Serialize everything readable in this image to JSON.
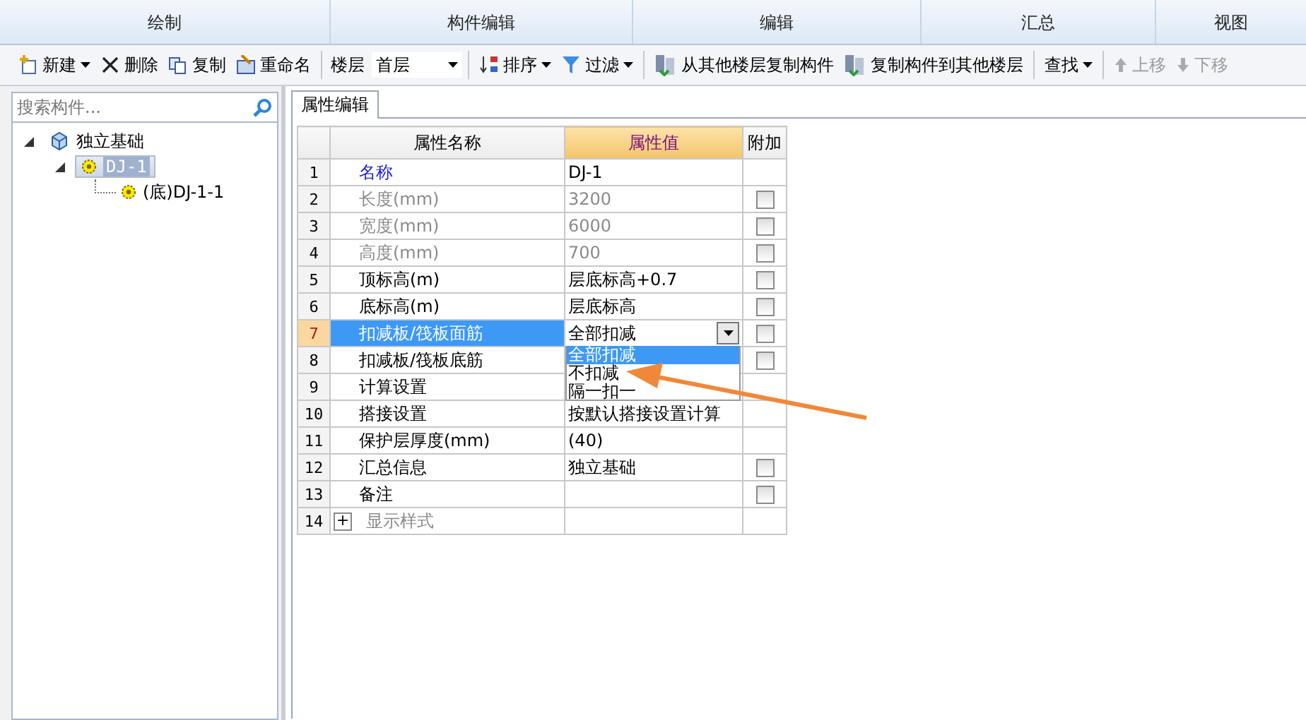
{
  "menu_tabs": [
    {
      "label": "绘制"
    },
    {
      "label": "构件编辑"
    },
    {
      "label": "编辑"
    },
    {
      "label": "汇总"
    },
    {
      "label": "视图"
    }
  ],
  "toolbar": [
    {
      "kind": "button",
      "label": "新建",
      "menu": true,
      "disabled": false
    },
    {
      "kind": "button",
      "label": "删除",
      "menu": false,
      "disabled": false
    },
    {
      "kind": "button",
      "label": "复制",
      "menu": false,
      "disabled": false
    },
    {
      "kind": "button",
      "label": "重命名",
      "menu": false,
      "disabled": false
    },
    {
      "kind": "separator"
    },
    {
      "kind": "label",
      "label": "楼层"
    },
    {
      "kind": "select",
      "value": "首层"
    },
    {
      "kind": "separator"
    },
    {
      "kind": "button",
      "label": "排序",
      "menu": true,
      "disabled": false
    },
    {
      "kind": "button",
      "label": "过滤",
      "menu": true,
      "disabled": false
    },
    {
      "kind": "separator"
    },
    {
      "kind": "button",
      "label": "从其他楼层复制构件",
      "menu": false,
      "disabled": false
    },
    {
      "kind": "button",
      "label": "复制构件到其他楼层",
      "menu": false,
      "disabled": false
    },
    {
      "kind": "separator"
    },
    {
      "kind": "button",
      "label": "查找",
      "menu": true,
      "disabled": false
    },
    {
      "kind": "separator"
    },
    {
      "kind": "button",
      "label": "上移",
      "menu": false,
      "disabled": true
    },
    {
      "kind": "button",
      "label": "下移",
      "menu": false,
      "disabled": true
    }
  ],
  "sidebar": {
    "search": {
      "placeholder": "搜索构件..."
    },
    "tree": [
      {
        "label": "独立基础",
        "expanded": true,
        "selected": false,
        "children": [
          {
            "label": "DJ-1",
            "expanded": true,
            "selected": true,
            "children": [
              {
                "label": "(底)DJ-1-1",
                "selected": false
              }
            ]
          }
        ]
      }
    ]
  },
  "editor": {
    "tab": "属性编辑",
    "columns": [
      {
        "label": "属性名称",
        "sorted": false
      },
      {
        "label": "属性值",
        "sorted": true
      },
      {
        "label": "附加",
        "sorted": false
      }
    ],
    "rows": [
      {
        "no": "1",
        "kind": "link",
        "name": "名称",
        "disabled": false,
        "value": "DJ-1",
        "selected": false
      },
      {
        "no": "2",
        "kind": "text",
        "name": "长度(mm)",
        "disabled": true,
        "value": "3200",
        "checked": false,
        "selected": false
      },
      {
        "no": "3",
        "kind": "text",
        "name": "宽度(mm)",
        "disabled": true,
        "value": "6000",
        "checked": false,
        "selected": false
      },
      {
        "no": "4",
        "kind": "text",
        "name": "高度(mm)",
        "disabled": true,
        "value": "700",
        "checked": false,
        "selected": false
      },
      {
        "no": "5",
        "kind": "text",
        "name": "顶标高(m)",
        "disabled": false,
        "value": "层底标高+0.7",
        "checked": false,
        "selected": false
      },
      {
        "no": "6",
        "kind": "text",
        "name": "底标高(m)",
        "disabled": false,
        "value": "层底标高",
        "checked": false,
        "selected": false
      },
      {
        "no": "7",
        "kind": "text",
        "name": "扣减板/筏板面筋",
        "disabled": false,
        "value": "全部扣减",
        "combo": true,
        "checked": false,
        "selected": true
      },
      {
        "no": "8",
        "kind": "text",
        "name": "扣减板/筏板底筋",
        "disabled": false,
        "checked": false,
        "selected": false
      },
      {
        "no": "9",
        "kind": "text",
        "name": "计算设置",
        "disabled": false,
        "selected": false
      },
      {
        "no": "10",
        "kind": "text",
        "name": "搭接设置",
        "disabled": false,
        "value": "按默认搭接设置计算",
        "selected": false
      },
      {
        "no": "11",
        "kind": "text",
        "name": "保护层厚度(mm)",
        "disabled": false,
        "value": "(40)",
        "selected": false
      },
      {
        "no": "12",
        "kind": "text",
        "name": "汇总信息",
        "disabled": false,
        "value": "独立基础",
        "checked": false,
        "selected": false
      },
      {
        "no": "13",
        "kind": "text",
        "name": "备注",
        "disabled": false,
        "checked": false,
        "selected": false
      },
      {
        "no": "14",
        "kind": "group",
        "expander": "+",
        "name": "显示样式",
        "disabled": true,
        "selected": false
      }
    ],
    "dropdown": {
      "options": [
        {
          "label": "全部扣减",
          "selected": true
        },
        {
          "label": "不扣减",
          "selected": false
        },
        {
          "label": "隔一扣一",
          "selected": false
        }
      ]
    }
  }
}
